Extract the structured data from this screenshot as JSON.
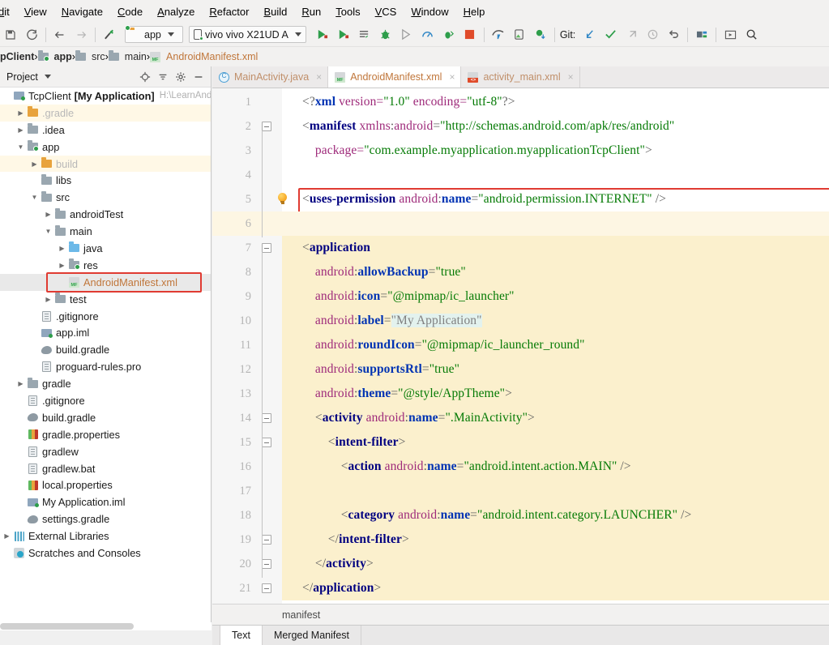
{
  "menubar": {
    "items": [
      "dit",
      "View",
      "Navigate",
      "Code",
      "Analyze",
      "Refactor",
      "Build",
      "Run",
      "Tools",
      "VCS",
      "Window",
      "Help"
    ]
  },
  "toolbar": {
    "module_selector": "app",
    "device_selector": "vivo vivo X21UD A",
    "git_label": "Git:",
    "icons": [
      "save-all-icon",
      "sync-icon",
      "back-arrow-icon",
      "forward-arrow-icon",
      "build-hammer-icon",
      "run-icon",
      "debug-attach-icon",
      "app-inspection-icon",
      "debug-bug-icon",
      "run-coverage-icon",
      "profiler-icon",
      "attach-debugger-icon",
      "stop-icon",
      "sdk-manager-icon",
      "avd-manager-icon",
      "sync-gradle-icon",
      "git-update-icon",
      "git-commit-icon",
      "git-push-icon",
      "git-history-icon",
      "git-revert-icon",
      "project-structure-icon",
      "layout-editor-icon",
      "search-icon"
    ]
  },
  "breadcrumb": {
    "items": [
      {
        "label": "pClient",
        "icon": "none",
        "style": "bold"
      },
      {
        "label": "app",
        "icon": "folder-module-icon",
        "style": "bold"
      },
      {
        "label": "src",
        "icon": "folder-icon",
        "style": "normal"
      },
      {
        "label": "main",
        "icon": "folder-icon",
        "style": "normal"
      },
      {
        "label": "AndroidManifest.xml",
        "icon": "manifest-icon",
        "style": "file"
      }
    ]
  },
  "sidebar": {
    "title": "Project",
    "header_icons": [
      "target-locate-icon",
      "collapse-all-icon",
      "settings-gear-icon",
      "hide-minus-icon"
    ],
    "tree": [
      {
        "label": "TcpClient",
        "bold_label": "[My Application]",
        "path": "H:\\LearnAndr",
        "icon": "project-icon",
        "indent": 0,
        "arrow": "down",
        "arrow_hidden": true
      },
      {
        "label": ".gradle",
        "icon": "folder-orange-icon",
        "indent": 1,
        "arrow": "right",
        "highlight": "yellow"
      },
      {
        "label": ".idea",
        "icon": "folder-icon",
        "indent": 1,
        "arrow": "right"
      },
      {
        "label": "app",
        "icon": "folder-module-icon",
        "indent": 1,
        "arrow": "down"
      },
      {
        "label": "build",
        "icon": "folder-orange-icon",
        "indent": 2,
        "arrow": "right",
        "highlight": "yellow"
      },
      {
        "label": "libs",
        "icon": "folder-icon",
        "indent": 2,
        "arrow": "none"
      },
      {
        "label": "src",
        "icon": "folder-icon",
        "indent": 2,
        "arrow": "down"
      },
      {
        "label": "androidTest",
        "icon": "folder-icon",
        "indent": 3,
        "arrow": "right"
      },
      {
        "label": "main",
        "icon": "folder-icon",
        "indent": 3,
        "arrow": "down"
      },
      {
        "label": "java",
        "icon": "folder-blue-icon",
        "indent": 4,
        "arrow": "right"
      },
      {
        "label": "res",
        "icon": "folder-res-icon",
        "indent": 4,
        "arrow": "right"
      },
      {
        "label": "AndroidManifest.xml",
        "icon": "manifest-icon",
        "indent": 4,
        "arrow": "none",
        "selected": true,
        "boxed": true
      },
      {
        "label": "test",
        "icon": "folder-icon",
        "indent": 3,
        "arrow": "right"
      },
      {
        "label": ".gitignore",
        "icon": "file-icon",
        "indent": 2,
        "arrow": "none"
      },
      {
        "label": "app.iml",
        "icon": "iml-icon",
        "indent": 2,
        "arrow": "none"
      },
      {
        "label": "build.gradle",
        "icon": "gradle-icon",
        "indent": 2,
        "arrow": "none"
      },
      {
        "label": "proguard-rules.pro",
        "icon": "file-icon",
        "indent": 2,
        "arrow": "none"
      },
      {
        "label": "gradle",
        "icon": "folder-icon",
        "indent": 1,
        "arrow": "right"
      },
      {
        "label": ".gitignore",
        "icon": "file-icon",
        "indent": 1,
        "arrow": "none"
      },
      {
        "label": "build.gradle",
        "icon": "gradle-icon",
        "indent": 1,
        "arrow": "none"
      },
      {
        "label": "gradle.properties",
        "icon": "properties-icon",
        "indent": 1,
        "arrow": "none"
      },
      {
        "label": "gradlew",
        "icon": "file-icon",
        "indent": 1,
        "arrow": "none"
      },
      {
        "label": "gradlew.bat",
        "icon": "file-icon",
        "indent": 1,
        "arrow": "none"
      },
      {
        "label": "local.properties",
        "icon": "properties-icon",
        "indent": 1,
        "arrow": "none"
      },
      {
        "label": "My Application.iml",
        "icon": "iml-icon",
        "indent": 1,
        "arrow": "none"
      },
      {
        "label": "settings.gradle",
        "icon": "gradle-icon",
        "indent": 1,
        "arrow": "none"
      },
      {
        "label": "External Libraries",
        "icon": "library-icon",
        "indent": 0,
        "arrow": "right",
        "arrow_hidden": true
      },
      {
        "label": "Scratches and Consoles",
        "icon": "scratches-icon",
        "indent": 0,
        "arrow": "none"
      }
    ]
  },
  "editor": {
    "tabs": [
      {
        "label": "MainActivity.java",
        "icon": "java-class-icon",
        "active": false
      },
      {
        "label": "AndroidManifest.xml",
        "icon": "manifest-icon",
        "active": true
      },
      {
        "label": "activity_main.xml",
        "icon": "layout-xml-icon",
        "active": false
      }
    ],
    "first_line": 1,
    "lines": [
      {
        "n": 1,
        "segments": [
          {
            "t": "<?",
            "c": "s-angle"
          },
          {
            "t": "xml",
            "c": "s-pi"
          },
          {
            "t": " version=",
            "c": "s-attr"
          },
          {
            "t": "\"1.0\"",
            "c": "s-val"
          },
          {
            "t": " encoding=",
            "c": "s-attr"
          },
          {
            "t": "\"utf-8\"",
            "c": "s-val"
          },
          {
            "t": "?>",
            "c": "s-angle"
          }
        ]
      },
      {
        "n": 2,
        "segments": [
          {
            "t": "<",
            "c": "s-angle"
          },
          {
            "t": "manifest",
            "c": "s-tag"
          },
          {
            "t": " xmlns",
            "c": "s-attr"
          },
          {
            "t": ":",
            "c": "s-angle"
          },
          {
            "t": "android",
            "c": "s-attr"
          },
          {
            "t": "=",
            "c": "s-angle"
          },
          {
            "t": "\"http://schemas.android.com/apk/res/android\"",
            "c": "s-val"
          }
        ],
        "fold": "start"
      },
      {
        "n": 3,
        "segments": [
          {
            "t": "    package=",
            "c": "s-attr"
          },
          {
            "t": "\"com.example.myapplication.myapplicationTcpClient\"",
            "c": "s-val"
          },
          {
            "t": ">",
            "c": "s-angle"
          }
        ]
      },
      {
        "n": 4,
        "segments": []
      },
      {
        "n": 5,
        "segments": [
          {
            "t": "<",
            "c": "s-angle"
          },
          {
            "t": "uses-permission",
            "c": "s-tag"
          },
          {
            "t": " android",
            "c": "s-attr"
          },
          {
            "t": ":",
            "c": "s-angle"
          },
          {
            "t": "name",
            "c": "s-attr2"
          },
          {
            "t": "=",
            "c": "s-angle"
          },
          {
            "t": "\"android.permission.INTERNET\"",
            "c": "s-val"
          },
          {
            "t": " />",
            "c": "s-angle"
          }
        ],
        "bulb": true,
        "boxed": true
      },
      {
        "n": 6,
        "segments": [],
        "caret": true
      },
      {
        "n": 7,
        "segments": [
          {
            "t": "<",
            "c": "s-angle"
          },
          {
            "t": "application",
            "c": "s-tag"
          }
        ],
        "fold": "start",
        "band": true
      },
      {
        "n": 8,
        "segments": [
          {
            "t": "    android",
            "c": "s-attr"
          },
          {
            "t": ":",
            "c": "s-angle"
          },
          {
            "t": "allowBackup",
            "c": "s-attr2"
          },
          {
            "t": "=",
            "c": "s-angle"
          },
          {
            "t": "\"true\"",
            "c": "s-val"
          }
        ],
        "band": true
      },
      {
        "n": 9,
        "segments": [
          {
            "t": "    android",
            "c": "s-attr"
          },
          {
            "t": ":",
            "c": "s-angle"
          },
          {
            "t": "icon",
            "c": "s-attr2"
          },
          {
            "t": "=",
            "c": "s-angle"
          },
          {
            "t": "\"@mipmap/ic_launcher\"",
            "c": "s-val"
          }
        ],
        "band": true
      },
      {
        "n": 10,
        "segments": [
          {
            "t": "    android",
            "c": "s-attr"
          },
          {
            "t": ":",
            "c": "s-angle"
          },
          {
            "t": "label",
            "c": "s-attr2"
          },
          {
            "t": "=",
            "c": "s-angle"
          },
          {
            "t": "\"My Application\"",
            "c": "s-valgray",
            "sel": true
          }
        ],
        "band": true
      },
      {
        "n": 11,
        "segments": [
          {
            "t": "    android",
            "c": "s-attr"
          },
          {
            "t": ":",
            "c": "s-angle"
          },
          {
            "t": "roundIcon",
            "c": "s-attr2"
          },
          {
            "t": "=",
            "c": "s-angle"
          },
          {
            "t": "\"@mipmap/ic_launcher_round\"",
            "c": "s-val"
          }
        ],
        "band": true
      },
      {
        "n": 12,
        "segments": [
          {
            "t": "    android",
            "c": "s-attr"
          },
          {
            "t": ":",
            "c": "s-angle"
          },
          {
            "t": "supportsRtl",
            "c": "s-attr2"
          },
          {
            "t": "=",
            "c": "s-angle"
          },
          {
            "t": "\"true\"",
            "c": "s-val"
          }
        ],
        "band": true
      },
      {
        "n": 13,
        "segments": [
          {
            "t": "    android",
            "c": "s-attr"
          },
          {
            "t": ":",
            "c": "s-angle"
          },
          {
            "t": "theme",
            "c": "s-attr2"
          },
          {
            "t": "=",
            "c": "s-angle"
          },
          {
            "t": "\"@style/AppTheme\"",
            "c": "s-val"
          },
          {
            "t": ">",
            "c": "s-angle"
          }
        ],
        "band": true
      },
      {
        "n": 14,
        "segments": [
          {
            "t": "    <",
            "c": "s-angle"
          },
          {
            "t": "activity",
            "c": "s-tag"
          },
          {
            "t": " android",
            "c": "s-attr"
          },
          {
            "t": ":",
            "c": "s-angle"
          },
          {
            "t": "name",
            "c": "s-attr2"
          },
          {
            "t": "=",
            "c": "s-angle"
          },
          {
            "t": "\".MainActivity\"",
            "c": "s-val"
          },
          {
            "t": ">",
            "c": "s-angle"
          }
        ],
        "fold": "start",
        "band": true
      },
      {
        "n": 15,
        "segments": [
          {
            "t": "        <",
            "c": "s-angle"
          },
          {
            "t": "intent-filter",
            "c": "s-tag"
          },
          {
            "t": ">",
            "c": "s-angle"
          }
        ],
        "fold": "start",
        "band": true
      },
      {
        "n": 16,
        "segments": [
          {
            "t": "            <",
            "c": "s-angle"
          },
          {
            "t": "action",
            "c": "s-tag"
          },
          {
            "t": " android",
            "c": "s-attr"
          },
          {
            "t": ":",
            "c": "s-angle"
          },
          {
            "t": "name",
            "c": "s-attr2"
          },
          {
            "t": "=",
            "c": "s-angle"
          },
          {
            "t": "\"android.intent.action.MAIN\"",
            "c": "s-val"
          },
          {
            "t": " />",
            "c": "s-angle"
          }
        ],
        "band": true
      },
      {
        "n": 17,
        "segments": [],
        "band": true
      },
      {
        "n": 18,
        "segments": [
          {
            "t": "            <",
            "c": "s-angle"
          },
          {
            "t": "category",
            "c": "s-tag"
          },
          {
            "t": " android",
            "c": "s-attr"
          },
          {
            "t": ":",
            "c": "s-angle"
          },
          {
            "t": "name",
            "c": "s-attr2"
          },
          {
            "t": "=",
            "c": "s-angle"
          },
          {
            "t": "\"android.intent.category.LAUNCHER\"",
            "c": "s-val"
          },
          {
            "t": " />",
            "c": "s-angle"
          }
        ],
        "band": true
      },
      {
        "n": 19,
        "segments": [
          {
            "t": "        </",
            "c": "s-angle"
          },
          {
            "t": "intent-filter",
            "c": "s-tag"
          },
          {
            "t": ">",
            "c": "s-angle"
          }
        ],
        "fold": "end",
        "band": true
      },
      {
        "n": 20,
        "segments": [
          {
            "t": "    </",
            "c": "s-angle"
          },
          {
            "t": "activity",
            "c": "s-tag"
          },
          {
            "t": ">",
            "c": "s-angle"
          }
        ],
        "fold": "end",
        "band": true
      },
      {
        "n": 21,
        "segments": [
          {
            "t": "</",
            "c": "s-angle"
          },
          {
            "t": "application",
            "c": "s-tag"
          },
          {
            "t": ">",
            "c": "s-angle"
          }
        ],
        "fold": "end",
        "band": true
      }
    ]
  },
  "status": {
    "manifest_label": "manifest"
  },
  "bottom_tabs": [
    {
      "label": "Text",
      "active": true
    },
    {
      "label": "Merged Manifest",
      "active": false
    }
  ],
  "colors": {
    "accent_red_box": "#e03b32",
    "tab_active_text": "#c0763a",
    "code_highlight_band": "#fbf0cd",
    "tree_yellow": "#fff8e6",
    "selection": "#e3f2ee"
  }
}
